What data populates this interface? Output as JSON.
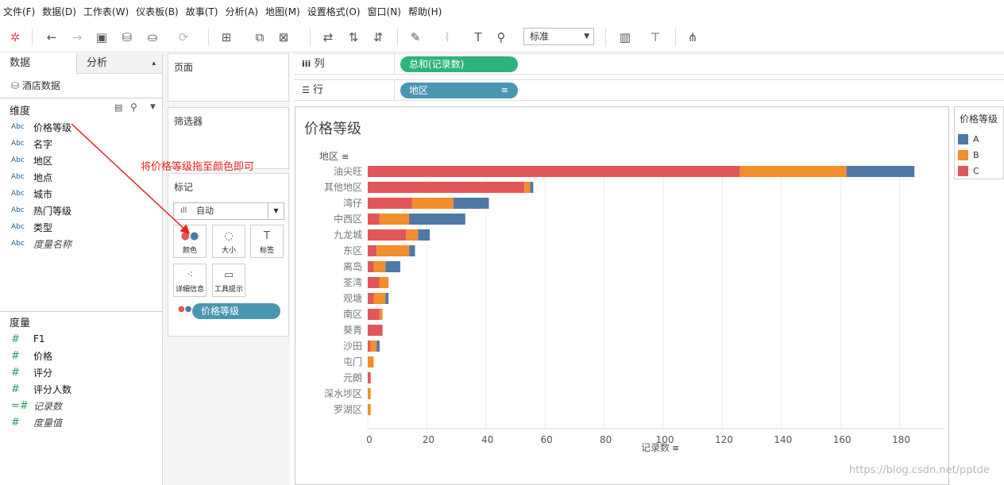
{
  "menu": [
    "文件(F)",
    "数据(D)",
    "工作表(W)",
    "仪表板(B)",
    "故事(T)",
    "分析(A)",
    "地图(M)",
    "设置格式(O)",
    "窗口(N)",
    "帮助(H)"
  ],
  "toolbar": {
    "fit_select": "标准"
  },
  "left": {
    "tab_data": "数据",
    "tab_analysis": "分析",
    "datasource": "酒店数据",
    "dimensions_title": "维度",
    "dimensions": [
      "价格等级",
      "名字",
      "地区",
      "地点",
      "城市",
      "热门等级",
      "类型",
      "度量名称"
    ],
    "abc_tag": "Abc",
    "measures_title": "度量",
    "measures": [
      "F1",
      "价格",
      "评分",
      "评分人数",
      "记录数",
      "度量值"
    ]
  },
  "cards": {
    "pages": "页面",
    "filters": "筛选器",
    "marks": "标记",
    "mark_type": "自动",
    "btn_color": "颜色",
    "btn_size": "大小",
    "btn_label": "标签",
    "btn_detail": "详细信息",
    "btn_tooltip": "工具提示",
    "color_pill": "价格等级"
  },
  "shelves": {
    "columns_label": "列",
    "columns_pill": "总和(记录数)",
    "rows_label": "行",
    "rows_pill": "地区"
  },
  "annotation": "将价格等级拖至颜色即可",
  "watermark": "https://blog.csdn.net/pptde",
  "colors": {
    "A": "#4e79a7",
    "B": "#f28e2b",
    "C": "#e15759",
    "pill_green": "#2fb37d",
    "pill_blue": "#4996b2"
  },
  "chart_data": {
    "type": "bar",
    "title": "价格等级",
    "ylabel": "地区",
    "xlabel": "记录数",
    "categories": [
      "油尖旺",
      "其他地区",
      "湾仔",
      "中西区",
      "九龙城",
      "东区",
      "离岛",
      "荃湾",
      "观塘",
      "南区",
      "葵青",
      "沙田",
      "屯门",
      "元朗",
      "深水埗区",
      "罗湖区"
    ],
    "series": [
      {
        "name": "C",
        "values": [
          126,
          53,
          15,
          4,
          13,
          3,
          2,
          4,
          2,
          4,
          5,
          1,
          0,
          1,
          0,
          0
        ]
      },
      {
        "name": "B",
        "values": [
          36,
          2,
          14,
          10,
          4,
          11,
          4,
          3,
          4,
          1,
          0,
          2,
          2,
          0,
          1,
          1
        ]
      },
      {
        "name": "A",
        "values": [
          23,
          1,
          12,
          19,
          4,
          2,
          5,
          0,
          1,
          0,
          0,
          1,
          0,
          0,
          0,
          0
        ]
      }
    ],
    "xlim": [
      0,
      190
    ],
    "xticks": [
      0,
      20,
      40,
      60,
      80,
      100,
      120,
      140,
      160,
      180
    ],
    "legend_title": "价格等级",
    "legend": [
      "A",
      "B",
      "C"
    ],
    "legend_position": "right",
    "grid": true
  }
}
